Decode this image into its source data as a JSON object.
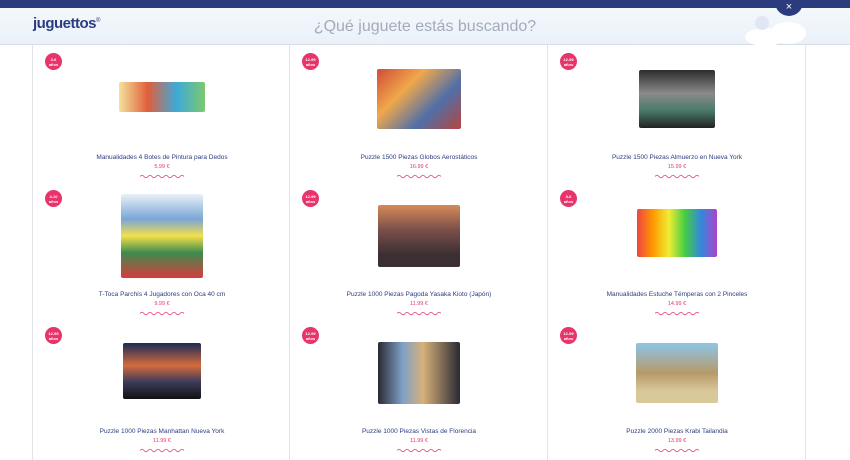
{
  "header": {
    "logo": "juguettos",
    "logo_mark": "®",
    "search_placeholder": "¿Qué juguete estás buscando?",
    "close_label": "×"
  },
  "colors": {
    "brand": "#2b3c7e",
    "accent": "#e8336b"
  },
  "products": [
    {
      "age": "3-6 años",
      "title": "Manualidades 4 Botes de Pintura para Dedos",
      "price": "5.99 €"
    },
    {
      "age": "12-99 años",
      "title": "Puzzle 1500 Piezas Globos Aerostáticos",
      "price": "16.99 €"
    },
    {
      "age": "12-99 años",
      "title": "Puzzle 1500 Piezas Almuerzo en Nueva York",
      "price": "15.99 €"
    },
    {
      "age": "4-10 años",
      "title": "T-Toca Parchís 4 Jugadores con Oca 40 cm",
      "price": "9.99 €"
    },
    {
      "age": "12-99 años",
      "title": "Puzzle 1000 Piezas Pagoda Yasaka Kioto (Japón)",
      "price": "11.99 €"
    },
    {
      "age": "3-6 años",
      "title": "Manualidades Estuche Témperas con 2 Pinceles",
      "price": "14.99 €"
    },
    {
      "age": "12-99 años",
      "title": "Puzzle 1000 Piezas Manhattan Nueva York",
      "price": "11.99 €"
    },
    {
      "age": "12-99 años",
      "title": "Puzzle 1000 Piezas Vistas de Florencia",
      "price": "11.99 €"
    },
    {
      "age": "12-99 años",
      "title": "Puzzle 2000 Piezas Krabi Tailandia",
      "price": "13.99 €"
    }
  ]
}
